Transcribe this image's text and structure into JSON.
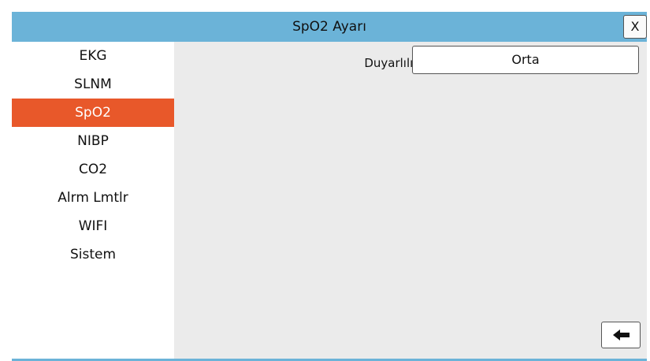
{
  "window": {
    "title": "SpO2 Ayarı",
    "close_label": "X"
  },
  "sidebar": {
    "items": [
      {
        "label": "EKG",
        "active": false
      },
      {
        "label": "SLNM",
        "active": false
      },
      {
        "label": "SpO2",
        "active": true
      },
      {
        "label": "NIBP",
        "active": false
      },
      {
        "label": "CO2",
        "active": false
      },
      {
        "label": "Alrm Lmtlr",
        "active": false
      },
      {
        "label": "WIFI",
        "active": false
      },
      {
        "label": "Sistem",
        "active": false
      }
    ]
  },
  "settings": {
    "sensitivity_label": "Duyarlılık",
    "sensitivity_value": "Orta"
  },
  "footer": {
    "back_icon": "arrow-left-icon"
  },
  "colors": {
    "titlebar": "#6bb3d8",
    "active_item": "#e8582a",
    "content_bg": "#ebebeb"
  }
}
